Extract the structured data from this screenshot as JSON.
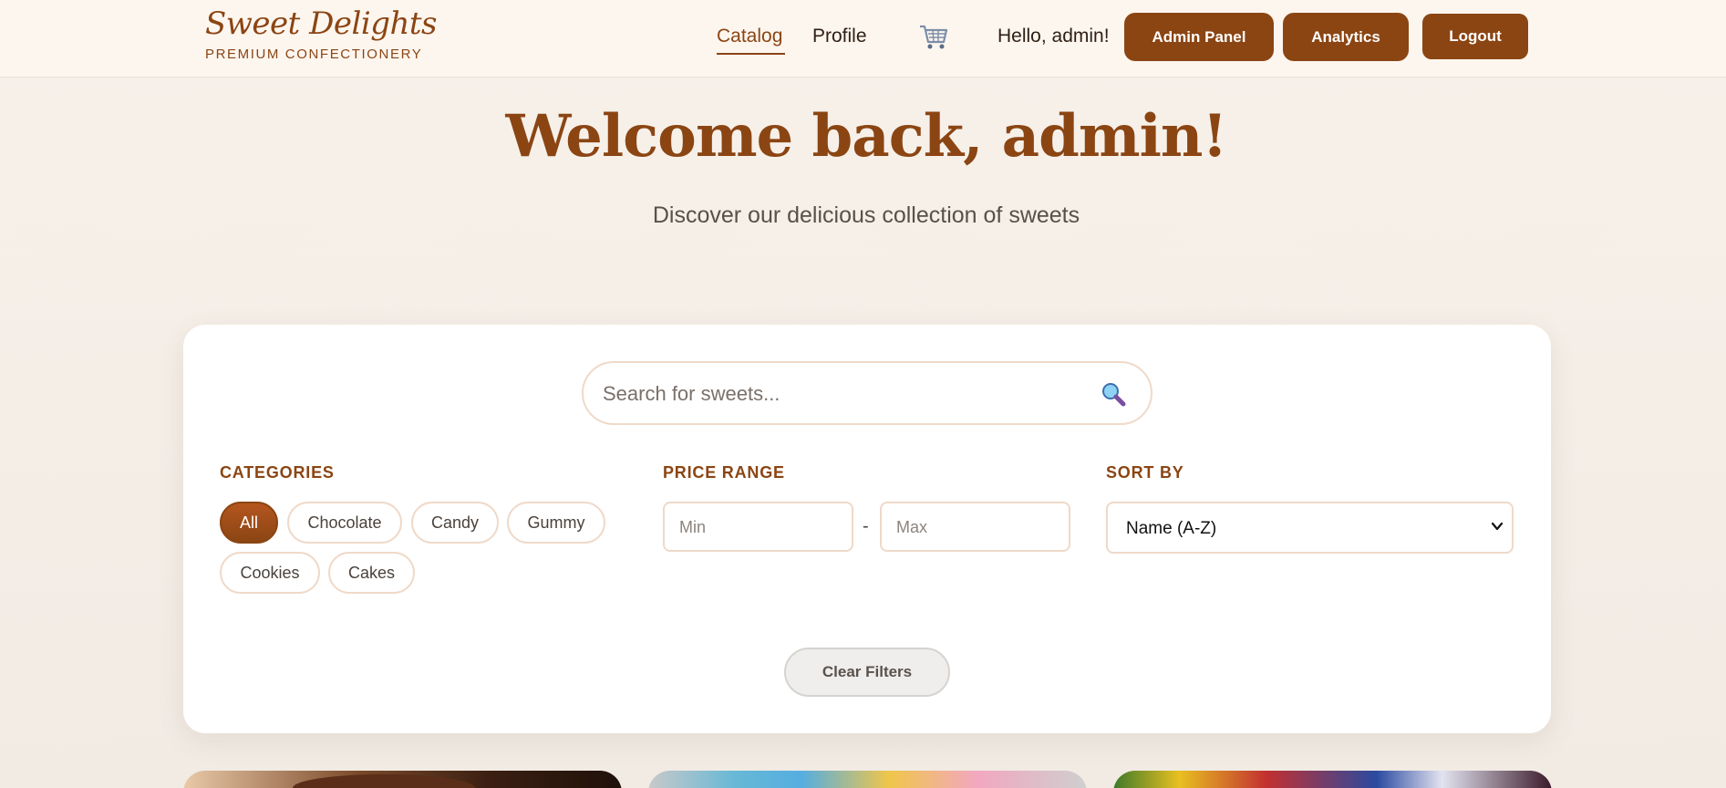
{
  "header": {
    "brand_name": "Sweet Delights",
    "brand_tagline": "PREMIUM CONFECTIONERY",
    "nav": {
      "catalog": "Catalog",
      "profile": "Profile"
    },
    "cart_icon": "cart-icon",
    "greeting": "Hello, admin!",
    "buttons": {
      "admin_panel": "Admin Panel",
      "analytics": "Analytics",
      "logout": "Logout"
    }
  },
  "hero": {
    "title": "Welcome back, admin!",
    "subtitle": "Discover our delicious collection of sweets"
  },
  "filters": {
    "search": {
      "placeholder": "Search for sweets...",
      "icon": "search-icon"
    },
    "categories": {
      "label": "CATEGORIES",
      "items": [
        "All",
        "Chocolate",
        "Candy",
        "Gummy",
        "Cookies",
        "Cakes"
      ],
      "selected": "All"
    },
    "price_range": {
      "label": "PRICE RANGE",
      "min_placeholder": "Min",
      "max_placeholder": "Max",
      "separator": "-"
    },
    "sort": {
      "label": "SORT BY",
      "value": "Name (A-Z)"
    },
    "clear_label": "Clear Filters"
  },
  "colors": {
    "brand": "#8b4513",
    "background": "#f4eee7",
    "card": "#ffffff",
    "border": "#efd9c8"
  }
}
